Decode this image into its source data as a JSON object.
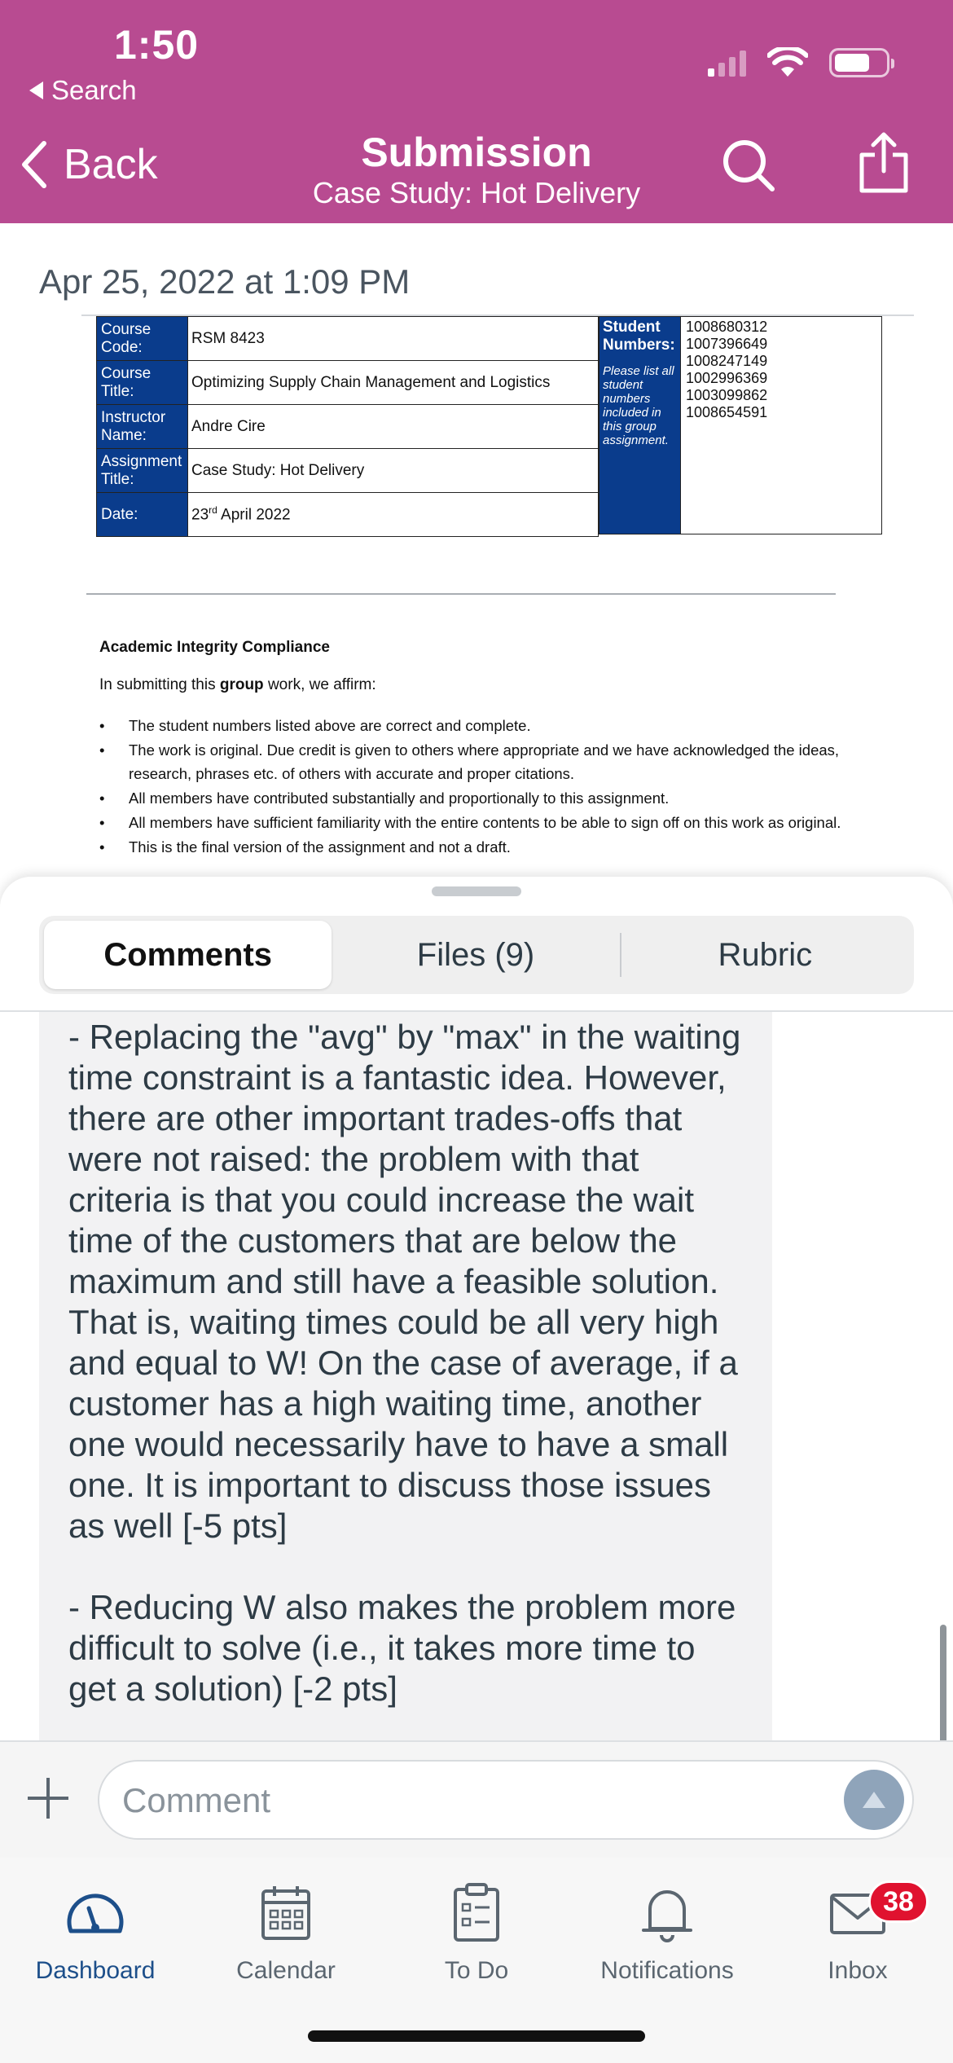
{
  "colors": {
    "brand": "#b84b91",
    "brand_dark": "#1d4f8a",
    "badge": "#e0122f",
    "table_header": "#0a3c8c"
  },
  "status_bar": {
    "time": "1:50",
    "back_label": "Search"
  },
  "nav": {
    "back_label": "Back",
    "title": "Submission",
    "subtitle": "Case Study: Hot Delivery",
    "search_icon": "search-icon",
    "share_icon": "share-icon"
  },
  "document": {
    "date": "Apr 25, 2022 at 1:09 PM",
    "cover": {
      "rows": [
        {
          "label": "Course Code:",
          "value": "RSM 8423"
        },
        {
          "label": "Course Title:",
          "value": "Optimizing Supply Chain Management and Logistics"
        },
        {
          "label": "Instructor Name:",
          "value": "Andre Cire"
        },
        {
          "label": "Assignment Title:",
          "value": "Case Study: Hot Delivery"
        },
        {
          "label": "Date:",
          "value": "23rd April 2022"
        }
      ],
      "students_heading": "Student Numbers:",
      "students_note": "Please list all student numbers included in this group assignment.",
      "student_numbers": [
        "1008680312",
        "1007396649",
        "1008247149",
        "1002996369",
        "1003099862",
        "1008654591"
      ]
    },
    "integrity": {
      "title": "Academic Integrity Compliance",
      "intro_prefix": "In submitting this ",
      "intro_bold": "group",
      "intro_suffix": " work, we affirm:",
      "items": [
        "The student numbers listed above are correct and complete.",
        "The work is original. Due credit is given to others where appropriate and we have acknowledged the ideas, research, phrases etc. of others with accurate and proper citations.",
        "All members have contributed substantially and proportionally to this assignment.",
        "All members have sufficient familiarity with the entire contents to be able to sign off on this work as original.",
        "This is the final version of the assignment and not a draft."
      ]
    }
  },
  "tabs": [
    {
      "label": "Comments",
      "active": true
    },
    {
      "label": "Files (9)",
      "active": false
    },
    {
      "label": "Rubric",
      "active": false
    }
  ],
  "comment": {
    "paragraphs": [
      "- Replacing the \"avg\" by \"max\" in the waiting time constraint is a fantastic idea. However, there are other important trades-offs that were not raised: the problem with that criteria is that you could increase the wait time of the customers that are below the maximum and still have a feasible solution. That is, waiting times could be all very high and equal to W! On the case of average, if a customer has a high waiting time, another one would necessarily have to have a small one. It is important to discuss those issues as well [-5 pts]",
      "- Reducing W also makes the problem more difficult to solve (i.e., it takes more time to get a solution) [-2 pts]"
    ]
  },
  "comment_input": {
    "placeholder": "Comment"
  },
  "tabbar": {
    "items": [
      {
        "label": "Dashboard",
        "icon": "dashboard-icon",
        "active": true
      },
      {
        "label": "Calendar",
        "icon": "calendar-icon",
        "active": false
      },
      {
        "label": "To Do",
        "icon": "todo-icon",
        "active": false
      },
      {
        "label": "Notifications",
        "icon": "bell-icon",
        "active": false
      },
      {
        "label": "Inbox",
        "icon": "mail-icon",
        "active": false,
        "badge": "38"
      }
    ]
  }
}
